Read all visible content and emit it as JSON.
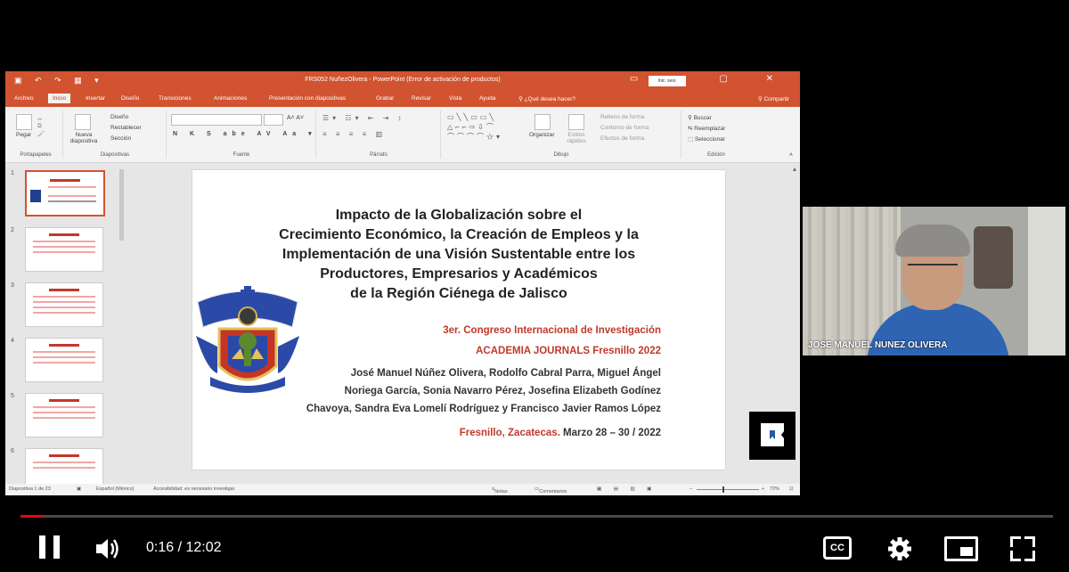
{
  "ppt": {
    "window_title": "FRS052 NuñezOlivera - PowerPoint (Error de activación de productos)",
    "signin_label": "Inic. sesi.",
    "tabs": [
      "Archivo",
      "Inicio",
      "Insertar",
      "Diseño",
      "Transiciones",
      "Animaciones",
      "Presentación con diapositivas",
      "Grabar",
      "Revisar",
      "Vista",
      "Ayuda",
      "¿Qué desea hacer?"
    ],
    "share_label": "Compartir",
    "ribbon": {
      "paste_label": "Pegar",
      "clipboard_group": "Portapapeles",
      "new_slide_label": "Nueva diapositiva",
      "design_label": "Diseño",
      "reset_label": "Restablecer",
      "section_label": "Sección",
      "slides_group": "Diapositivas",
      "font_group": "Fuente",
      "paragraph_group": "Párrafo",
      "arrange_label": "Organizar",
      "quick_styles_label": "Estilos rápidos",
      "shape_fill_label": "Relleno de forma",
      "shape_outline_label": "Contorno de forma",
      "shape_effects_label": "Efectos de forma",
      "drawing_group": "Dibujo",
      "find_label": "Buscar",
      "replace_label": "Reemplazar",
      "select_label": "Seleccionar",
      "editing_group": "Edición"
    },
    "thumbnails": [
      "1",
      "2",
      "3",
      "4",
      "5",
      "6"
    ],
    "slide": {
      "title_lines": [
        "Impacto de la Globalización sobre el",
        "Crecimiento Económico, la Creación de Empleos y la",
        "Implementación de una Visión Sustentable entre los",
        "Productores, Empresarios y Académicos",
        "de la Región  Ciénega de Jalisco"
      ],
      "congress": "3er. Congreso Internacional de Investigación",
      "journal": "ACADEMIA JOURNALS Fresnillo 2022",
      "authors_lines": [
        "José Manuel Núñez Olivera, Rodolfo Cabral Parra, Miguel Ángel",
        "Noriega García, Sonia Navarro Pérez, Josefina Elizabeth Godínez",
        "Chavoya, Sandra Eva Lomelí Rodríguez y Francisco Javier Ramos López"
      ],
      "place": "Fresnillo, Zacatecas.",
      "dates": " Marzo 28 – 30 / 2022"
    },
    "status": {
      "slide_count": "Diapositiva 1 de 23",
      "language": "Español (México)",
      "accessibility": "Accesibilidad: es necesario investigar",
      "notes": "Notas",
      "comments": "Comentarios",
      "zoom": "72%"
    }
  },
  "webcam": {
    "participant_name": "JOSE MANUEL NUNEZ OLIVERA"
  },
  "player": {
    "current_time": "0:16",
    "separator": " / ",
    "duration": "12:02",
    "progress_fraction": 0.022,
    "cc_label": "CC"
  },
  "colors": {
    "ppt_accent": "#d1532f",
    "slide_red": "#c0392b",
    "progress_red": "#ff0000"
  }
}
